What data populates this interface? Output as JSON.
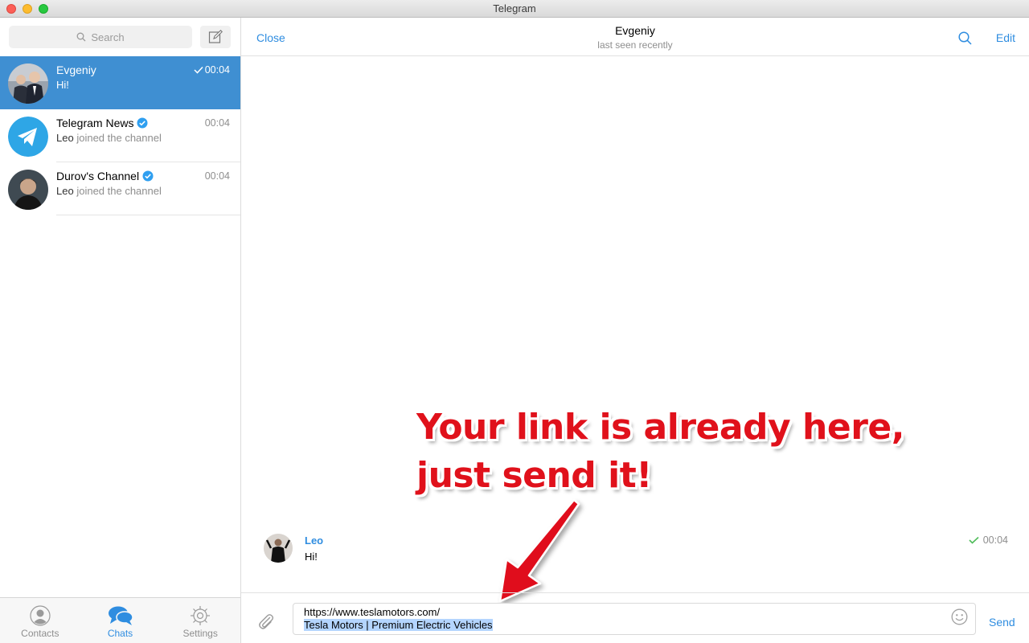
{
  "window": {
    "title": "Telegram"
  },
  "sidebar": {
    "search_placeholder": "Search",
    "chats": [
      {
        "name": "Evgeniy",
        "time": "00:04",
        "preview": "Hi!",
        "active": true,
        "read": true
      },
      {
        "name": "Telegram News",
        "time": "00:04",
        "preview_sender": "Leo",
        "preview": "joined the channel",
        "verified": true
      },
      {
        "name": "Durov's Channel",
        "time": "00:04",
        "preview_sender": "Leo",
        "preview": "joined the channel",
        "verified": true
      }
    ],
    "tabs": [
      {
        "label": "Contacts",
        "icon": "contacts-icon"
      },
      {
        "label": "Chats",
        "icon": "chats-icon",
        "active": true
      },
      {
        "label": "Settings",
        "icon": "settings-icon"
      }
    ]
  },
  "header": {
    "close_label": "Close",
    "title": "Evgeniy",
    "status": "last seen recently",
    "edit_label": "Edit"
  },
  "messages": [
    {
      "sender": "Leo",
      "text": "Hi!",
      "time": "00:04",
      "read": true
    }
  ],
  "annotation": {
    "line1": "Your link is already here,",
    "line2": "just send it!"
  },
  "composer": {
    "line1": "https://www.teslamotors.com/",
    "line2": "Tesla Motors | Premium Electric Vehicles",
    "send_label": "Send"
  },
  "colors": {
    "accent": "#2f8de0",
    "active_row": "#3f8fd2",
    "annotation": "#e0111b",
    "check_green": "#4fbc5a"
  }
}
